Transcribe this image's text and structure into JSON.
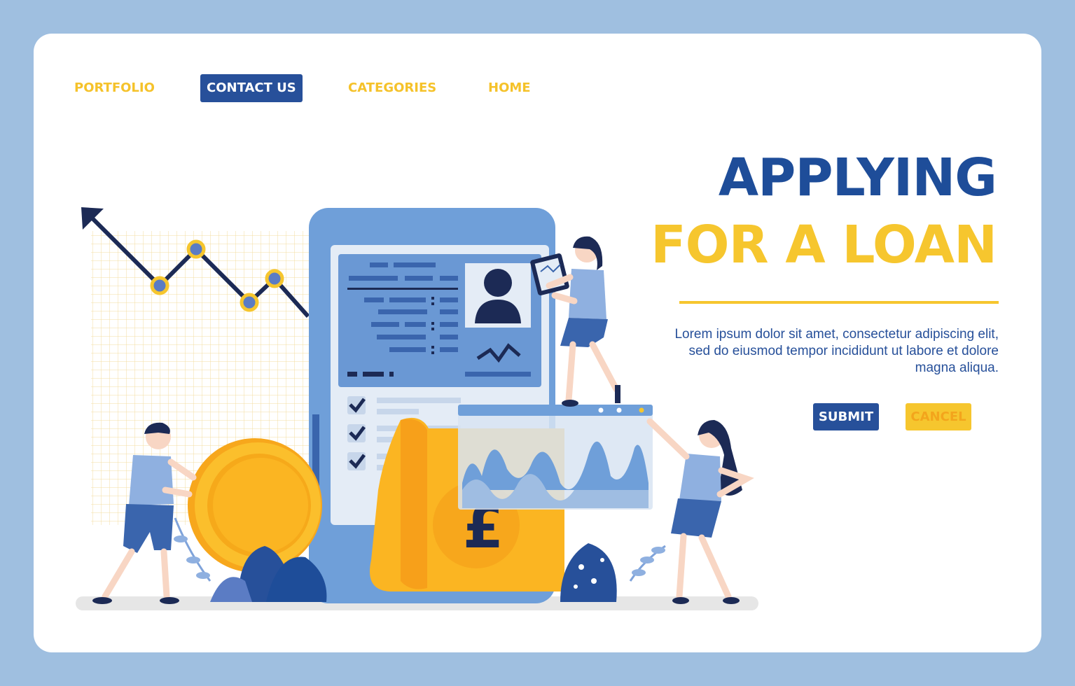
{
  "nav": {
    "items": [
      {
        "label": "PORTFOLIO",
        "active": false
      },
      {
        "label": "CONTACT US",
        "active": true
      },
      {
        "label": "CATEGORIES",
        "active": false
      },
      {
        "label": "HOME",
        "active": false
      }
    ]
  },
  "hero": {
    "title_line1": "APPLYING",
    "title_line2": "FOR A LOAN",
    "description": "Lorem ipsum dolor sit amet, consectetur adipiscing elit, sed do eiusmod tempor incididunt ut labore et dolore magna aliqua."
  },
  "buttons": {
    "submit": "SUBMIT",
    "cancel": "CANCEL"
  },
  "illustration": {
    "currency_symbol": "£",
    "icons": [
      "trend-down-chart",
      "phone-form",
      "coin",
      "invoice-scroll",
      "area-chart-window",
      "tablet",
      "plants",
      "people"
    ]
  },
  "colors": {
    "background": "#9fbfe0",
    "primary_blue": "#27509a",
    "accent_yellow": "#f6c62e"
  }
}
